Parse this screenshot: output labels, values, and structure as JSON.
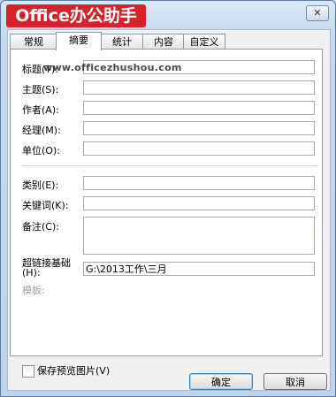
{
  "titlebar": {
    "close_symbol": "✕"
  },
  "watermark": {
    "logo_text": "Office办公助手",
    "url": "www.officezhushou.com"
  },
  "tabs": [
    "常规",
    "摘要",
    "统计",
    "内容",
    "自定义"
  ],
  "active_tab": "摘要",
  "fields": {
    "title": {
      "label": "标题(T):",
      "value": ""
    },
    "subject": {
      "label": "主题(S):",
      "value": ""
    },
    "author": {
      "label": "作者(A):",
      "value": ""
    },
    "manager": {
      "label": "经理(M):",
      "value": ""
    },
    "company": {
      "label": "单位(O):",
      "value": ""
    },
    "category": {
      "label": "类别(E):",
      "value": ""
    },
    "keywords": {
      "label": "关键词(K):",
      "value": ""
    },
    "comments": {
      "label": "备注(C):",
      "value": ""
    },
    "hyperlink_base": {
      "label": "超链接基础\n(H):",
      "value": "G:\\2013工作\\三月"
    },
    "template": {
      "label": "模板:",
      "value": ""
    }
  },
  "save_preview": {
    "label": "保存预览图片(V)",
    "checked": false
  },
  "buttons": {
    "ok": "确定",
    "cancel": "取消"
  }
}
